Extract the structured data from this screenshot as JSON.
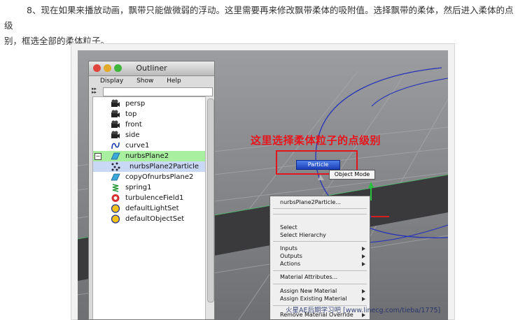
{
  "article": {
    "intro_line1": "8、现在如果来播放动画，飘带只能做微弱的浮动。这里需要再来修改飘带柔体的吸附值。选择飘带的柔体，然后进入柔体的点级",
    "intro_line2": "别，框选全部的柔体粒子。"
  },
  "outliner": {
    "title": "Outliner",
    "menu": [
      "Display",
      "Show",
      "Help"
    ],
    "items": [
      {
        "label": "persp",
        "icon": "camera-icon"
      },
      {
        "label": "top",
        "icon": "camera-icon"
      },
      {
        "label": "front",
        "icon": "camera-icon"
      },
      {
        "label": "side",
        "icon": "camera-icon"
      },
      {
        "label": "curve1",
        "icon": "curve-icon"
      },
      {
        "label": "nurbsPlane2",
        "icon": "nurbs-plane-icon"
      },
      {
        "label": "nurbsPlane2Particle",
        "icon": "particle-icon"
      },
      {
        "label": "copyOfnurbsPlane2",
        "icon": "nurbs-plane-icon"
      },
      {
        "label": "spring1",
        "icon": "spring-icon"
      },
      {
        "label": "turbulenceField1",
        "icon": "field-icon"
      },
      {
        "label": "defaultLightSet",
        "icon": "set-icon"
      },
      {
        "label": "defaultObjectSet",
        "icon": "set-icon"
      }
    ]
  },
  "annotation": "这里选择柔体粒子的点级别",
  "marking_menu": {
    "particle": "Particle",
    "object_mode": "Object Mode"
  },
  "context_menu": {
    "header": "nurbsPlane2Particle...",
    "select": "Select",
    "select_hierarchy": "Select Hierarchy",
    "inputs": "Inputs",
    "outputs": "Outputs",
    "actions": "Actions",
    "material_attributes": "Material Attributes...",
    "assign_new_material": "Assign New Material",
    "assign_existing_material": "Assign Existing Material",
    "remove_material_override": "Remove Material Override"
  },
  "watermark": "火星AE后期学习吧  [www.linecg.com/tieba/1775]"
}
